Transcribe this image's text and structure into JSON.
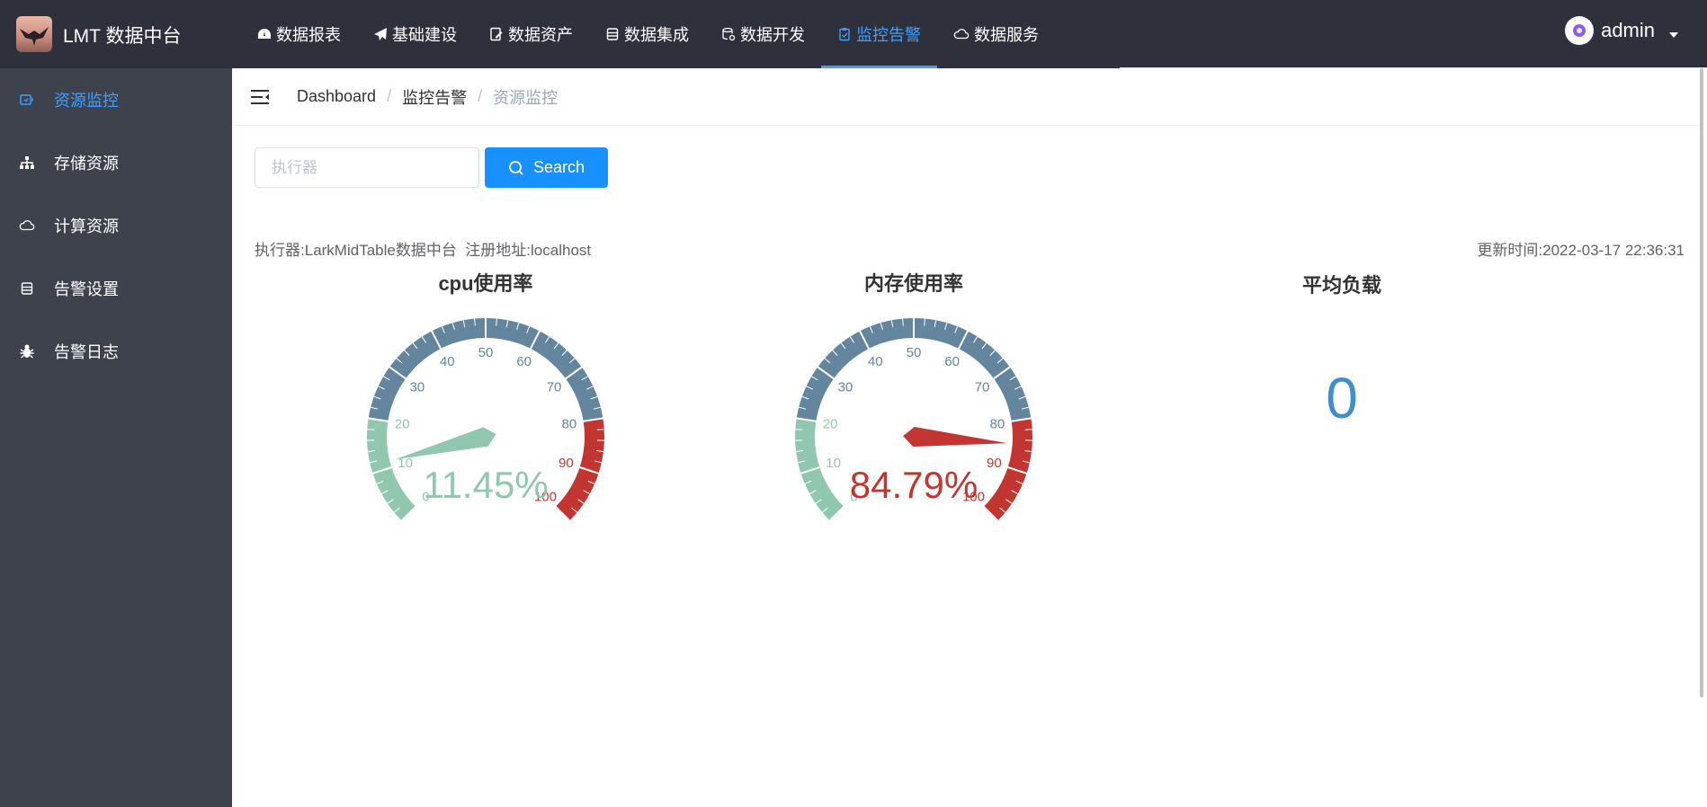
{
  "app": {
    "title": "LMT 数据中台"
  },
  "nav": [
    {
      "label": "数据报表",
      "icon": "dashboard-icon",
      "active": false
    },
    {
      "label": "基础建设",
      "icon": "send-icon",
      "active": false
    },
    {
      "label": "数据资产",
      "icon": "edit-doc-icon",
      "active": false
    },
    {
      "label": "数据集成",
      "icon": "database-icon",
      "active": false
    },
    {
      "label": "数据开发",
      "icon": "db-gear-icon",
      "active": false
    },
    {
      "label": "监控告警",
      "icon": "clipboard-icon",
      "active": true
    },
    {
      "label": "数据服务",
      "icon": "cloud-icon",
      "active": false
    }
  ],
  "user": {
    "name": "admin"
  },
  "sidebar": [
    {
      "label": "资源监控",
      "icon": "monitor-icon",
      "active": true
    },
    {
      "label": "存储资源",
      "icon": "tree-icon",
      "active": false
    },
    {
      "label": "计算资源",
      "icon": "cloud-icon",
      "active": false
    },
    {
      "label": "告警设置",
      "icon": "database-icon",
      "active": false
    },
    {
      "label": "告警日志",
      "icon": "bug-icon",
      "active": false
    }
  ],
  "breadcrumb": [
    "Dashboard",
    "监控告警",
    "资源监控"
  ],
  "search": {
    "placeholder": "执行器",
    "value": "",
    "button_label": "Search"
  },
  "info": {
    "executor_label": "执行器:",
    "executor_value": "LarkMidTable数据中台",
    "address_label": "注册地址:",
    "address_value": "localhost",
    "updated_label": "更新时间:",
    "updated_value": "2022-03-17 22:36:31"
  },
  "colors": {
    "accent": "#409eff",
    "button": "#1890ff",
    "gauge_low": "#91c7ae",
    "gauge_mid": "#63869e",
    "gauge_high": "#c23531",
    "load_value": "#3f8ed0"
  },
  "chart_data": [
    {
      "type": "gauge",
      "title": "cpu使用率",
      "value": 11.45,
      "display": "11.45%",
      "min": 0,
      "max": 100,
      "ticks": [
        0,
        10,
        20,
        30,
        40,
        50,
        60,
        70,
        80,
        90,
        100
      ],
      "bands": [
        {
          "to": 20,
          "color": "#91c7ae"
        },
        {
          "to": 80,
          "color": "#63869e"
        },
        {
          "to": 100,
          "color": "#c23531"
        }
      ]
    },
    {
      "type": "gauge",
      "title": "内存使用率",
      "value": 84.79,
      "display": "84.79%",
      "min": 0,
      "max": 100,
      "ticks": [
        0,
        10,
        20,
        30,
        40,
        50,
        60,
        70,
        80,
        90,
        100
      ],
      "bands": [
        {
          "to": 20,
          "color": "#91c7ae"
        },
        {
          "to": 80,
          "color": "#63869e"
        },
        {
          "to": 100,
          "color": "#c23531"
        }
      ]
    },
    {
      "type": "table",
      "title": "平均负载",
      "value": "0"
    }
  ]
}
